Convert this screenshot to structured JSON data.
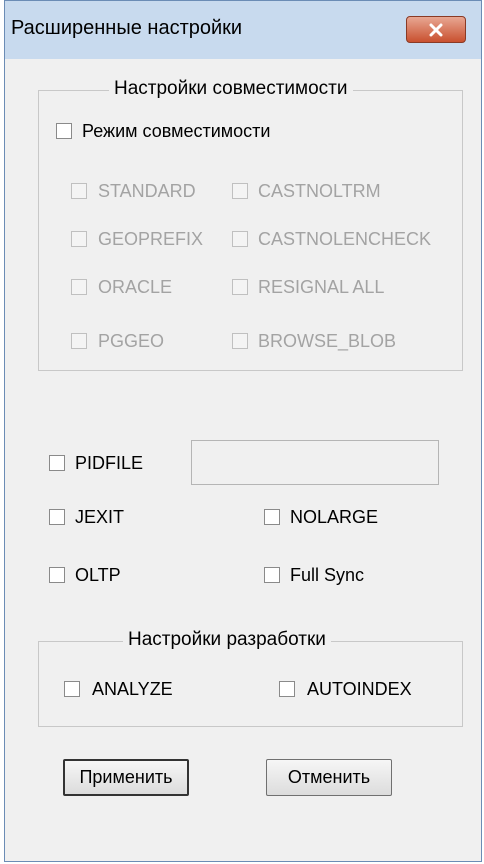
{
  "window": {
    "title": "Расширенные настройки"
  },
  "compat_group": {
    "title": "Настройки совместимости",
    "mode_label": "Режим совместимости",
    "options": {
      "standard": "STANDARD",
      "castnoltrm": "CASTNOLTRM",
      "geoprefix": "GEOPREFIX",
      "castnolencheck": "CASTNOLENCHECK",
      "oracle": "ORACLE",
      "resignal_all": "RESIGNAL ALL",
      "pggeo": "PGGEO",
      "browse_blob": "BROWSE_BLOB"
    }
  },
  "options": {
    "pidfile": "PIDFILE",
    "pidfile_value": "",
    "jexit": "JEXIT",
    "nolarge": "NOLARGE",
    "oltp": "OLTP",
    "full_sync": "Full Sync"
  },
  "dev_group": {
    "title": "Настройки разработки",
    "analyze": "ANALYZE",
    "autoindex": "AUTOINDEX"
  },
  "buttons": {
    "apply": "Применить",
    "cancel": "Отменить"
  },
  "icons": {
    "close": "close-icon"
  },
  "colors": {
    "close_button": "#c9502f",
    "titlebar": "#c8daee",
    "disabled_text": "#a3a3a3"
  }
}
